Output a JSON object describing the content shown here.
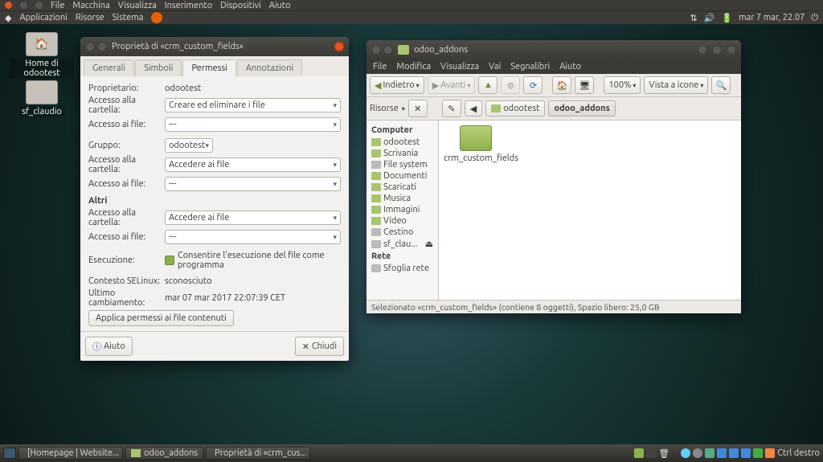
{
  "top_menu1": {
    "items": [
      "File",
      "Macchina",
      "Visualizza",
      "Inserimento",
      "Dispositivi",
      "Aiuto"
    ]
  },
  "top_menu2": {
    "apps": "Applicazioni",
    "risorse": "Risorse",
    "sistema": "Sistema",
    "clock": "mar  7 mar, 22.07"
  },
  "desktop": {
    "icon1": "Home di odootest",
    "icon2": "sf_claudio"
  },
  "props_window": {
    "title": "Proprietà di «crm_custom_fields»",
    "tabs": {
      "generali": "Generali",
      "simboli": "Simboli",
      "permessi": "Permessi",
      "annotazioni": "Annotazioni"
    },
    "labels": {
      "proprietario": "Proprietario:",
      "accesso_cartella": "Accesso alla cartella:",
      "accesso_file": "Accesso ai file:",
      "gruppo": "Gruppo:",
      "altri": "Altri",
      "esecuzione": "Esecuzione:",
      "consentire": "Consentire l'esecuzione del file come programma",
      "selinux": "Contesto SELinux:",
      "ultimo": "Ultimo cambiamento:",
      "applica": "Applica permessi ai file contenuti",
      "aiuto": "Aiuto",
      "chiudi": "Chiudi"
    },
    "values": {
      "proprietario": "odootest",
      "cartella_owner": "Creare ed eliminare i file",
      "file_owner": "---",
      "gruppo": "odootest",
      "cartella_group": "Accedere ai file",
      "file_group": "---",
      "cartella_other": "Accedere ai file",
      "file_other": "---",
      "selinux": "sconosciuto",
      "ultimo": "mar 07 mar 2017 22:07:39 CET"
    }
  },
  "nautilus": {
    "title": "odoo_addons",
    "menu": [
      "File",
      "Modifica",
      "Visualizza",
      "Vai",
      "Segnalibri",
      "Aiuto"
    ],
    "nav": {
      "indietro": "Indietro",
      "avanti": "Avanti"
    },
    "zoom": "100%",
    "viewmode": "Vista a icone",
    "path_label": "Risorse",
    "path": [
      "odootest",
      "odoo_addons"
    ],
    "sidebar": {
      "head1": "Computer",
      "items1": [
        "odootest",
        "Scrivania",
        "File system",
        "Documenti",
        "Scaricati",
        "Musica",
        "Immagini",
        "Video",
        "Cestino",
        "sf_clau..."
      ],
      "head2": "Rete",
      "items2": [
        "Sfoglia rete"
      ]
    },
    "content": {
      "folder1": "crm_custom_fields"
    },
    "status": "Selezionato «crm_custom_fields» (contiene 8 oggetti), Spazio libero: 25,0 GB"
  },
  "taskbar": {
    "items": [
      "[Homepage | Website...",
      "odoo_addons",
      "Proprietà di «crm_cus..."
    ],
    "right": "Ctrl destro"
  }
}
